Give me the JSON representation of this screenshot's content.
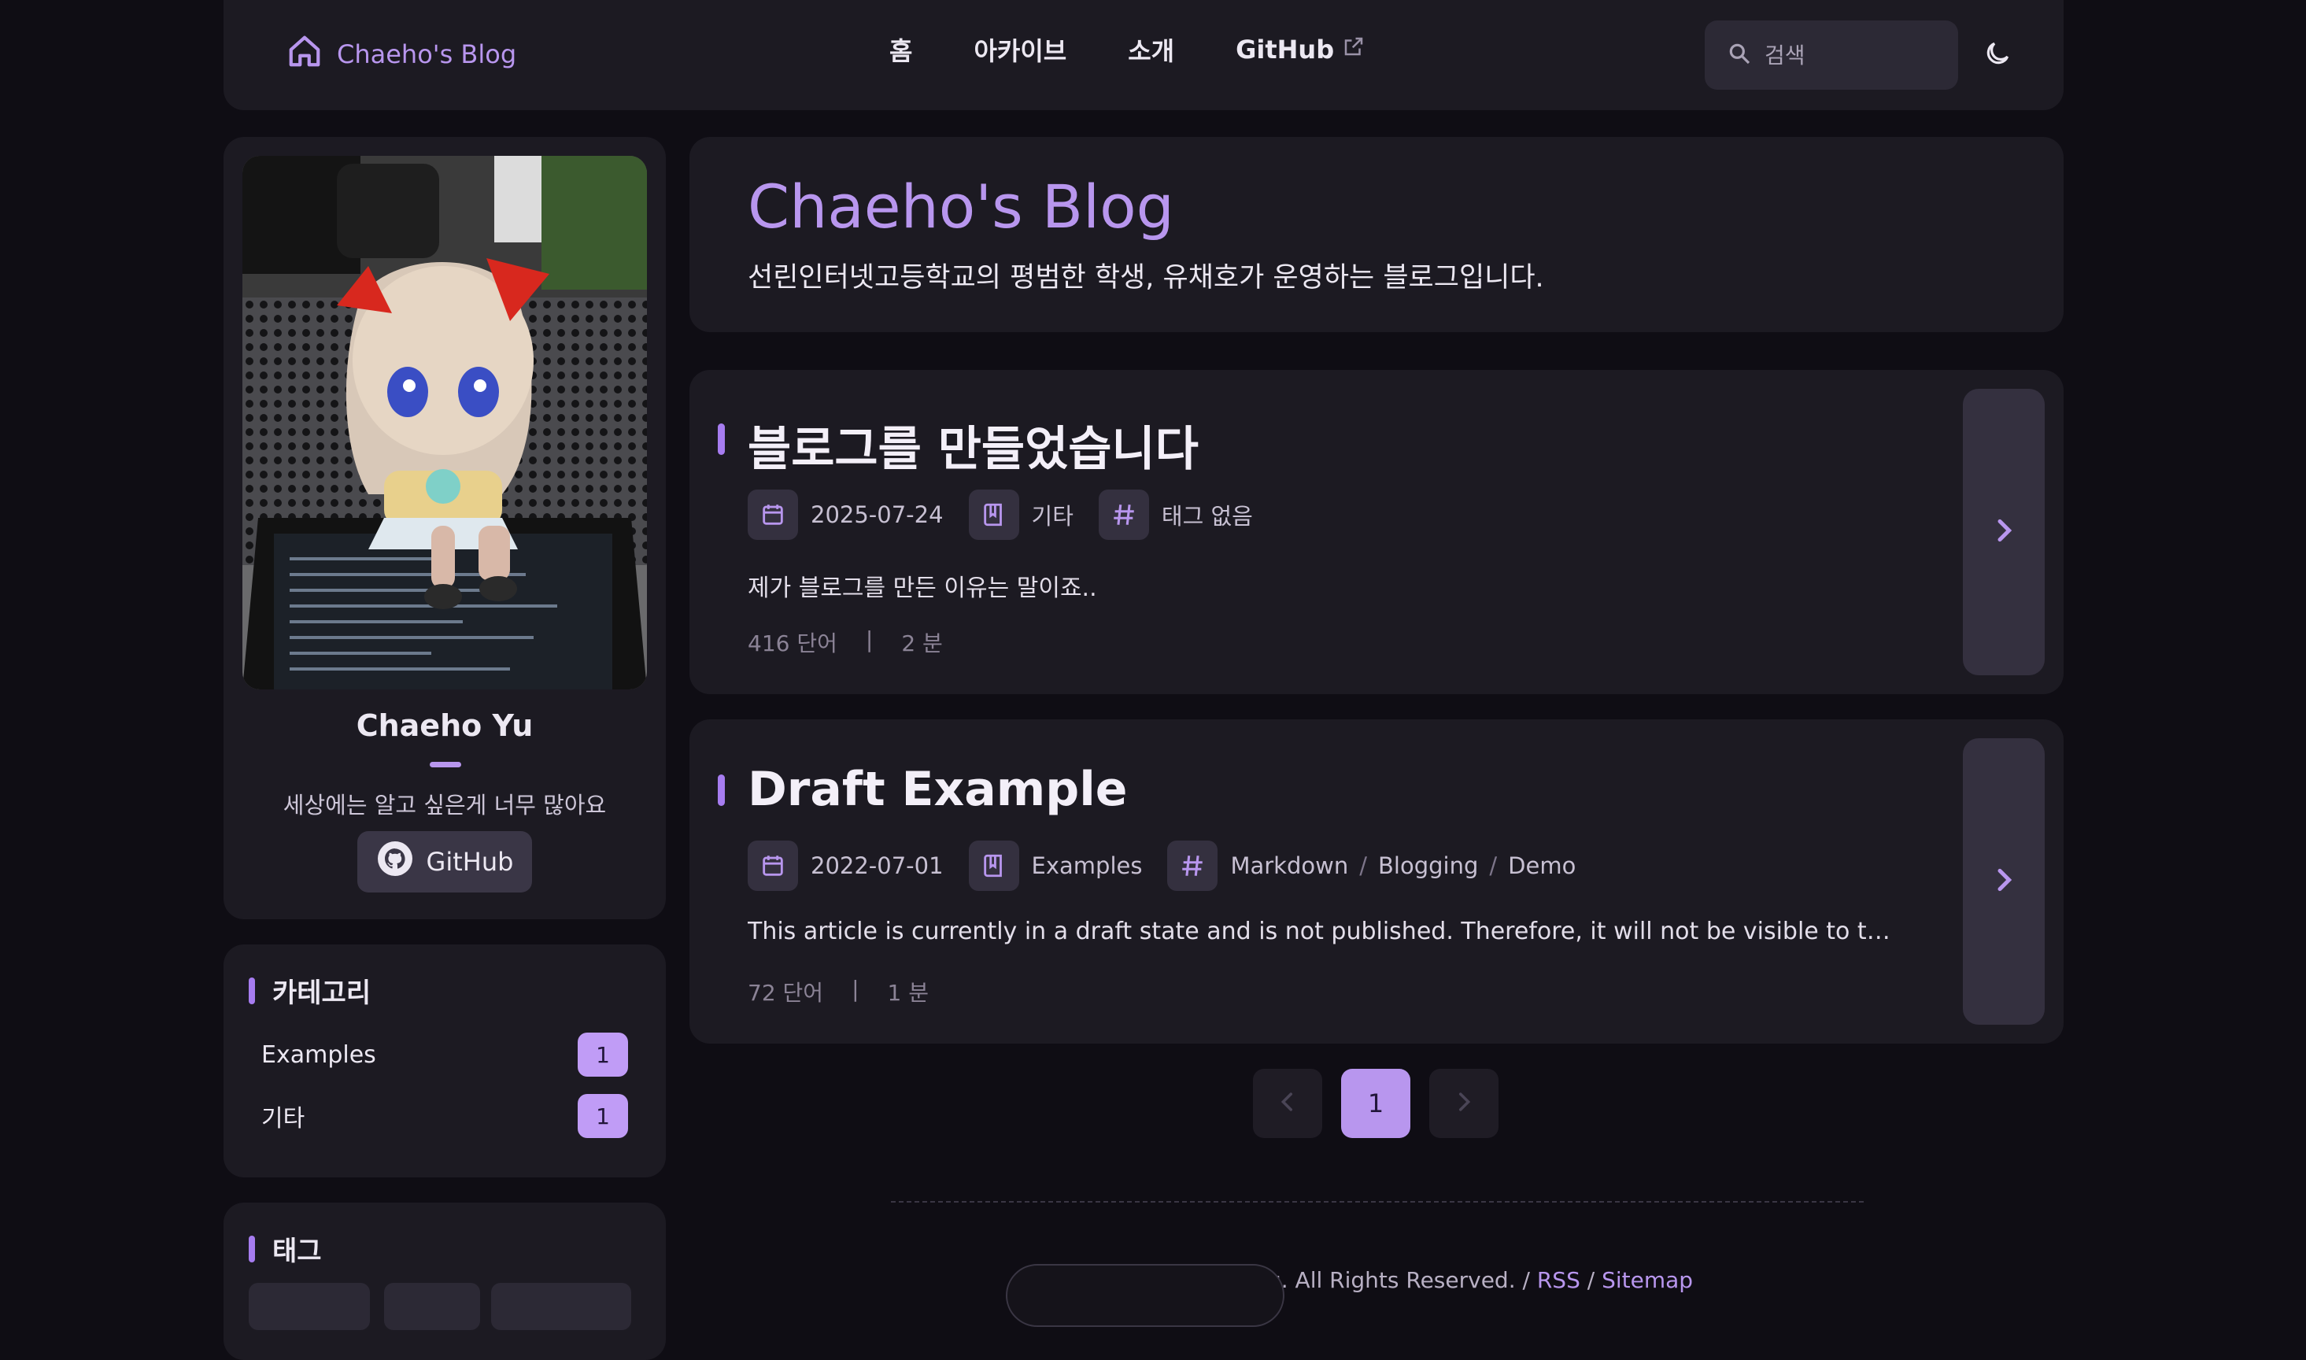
{
  "nav": {
    "brand": "Chaeho's Blog",
    "links": [
      "홈",
      "아카이브",
      "소개",
      "GitHub"
    ],
    "search_placeholder": "검색"
  },
  "profile": {
    "name": "Chaeho Yu",
    "bio": "세상에는 알고 싶은게 너무 많아요",
    "github_label": "GitHub"
  },
  "categories": {
    "title": "카테고리",
    "items": [
      {
        "label": "Examples",
        "count": "1"
      },
      {
        "label": "기타",
        "count": "1"
      }
    ]
  },
  "tags": {
    "title": "태그"
  },
  "hero": {
    "title": "Chaeho's Blog",
    "description": "선린인터넷고등학교의 평범한 학생, 유채호가 운영하는 블로그입니다."
  },
  "posts": [
    {
      "title": "블로그를 만들었습니다",
      "date": "2025-07-24",
      "category": "기타",
      "tags": [
        "태그 없음"
      ],
      "excerpt": "제가 블로그를 만든 이유는 말이죠..",
      "words": "416 단어",
      "divider": "|",
      "minutes": "2 분"
    },
    {
      "title": "Draft Example",
      "date": "2022-07-01",
      "category": "Examples",
      "tags": [
        "Markdown",
        "Blogging",
        "Demo"
      ],
      "tag_sep": "/",
      "excerpt": "This article is currently in a draft state and is not published. Therefore, it will not be visible to the general…",
      "words": "72 단어",
      "divider": "|",
      "minutes": "1 분"
    }
  ],
  "pagination": {
    "current": "1"
  },
  "footer": {
    "text": "u. All Rights Reserved. /",
    "rss": "RSS",
    "slash": "/",
    "sitemap": "Sitemap"
  },
  "colors": {
    "accent": "#b896ee",
    "background": "#0f0d14",
    "card": "#1c1a22"
  }
}
